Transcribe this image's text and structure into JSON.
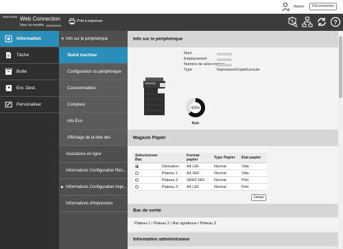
{
  "topbar": {
    "admin_label": "Admin",
    "logout_label": "Déconnexion"
  },
  "header": {
    "logo_text": "PAGE SCOPE",
    "title": "Web Connection",
    "model_label": "Nom de modèle",
    "status_label": "Prêt à imprimer"
  },
  "left_nav": [
    {
      "label": "Information",
      "icon": "info-icon",
      "active": true
    },
    {
      "label": "Tâche",
      "icon": "job-icon"
    },
    {
      "label": "Boîte",
      "icon": "box-icon"
    },
    {
      "label": "Enr. Dest.",
      "icon": "address-icon"
    },
    {
      "label": "Personaliser",
      "icon": "customize-icon"
    }
  ],
  "sub_nav": [
    {
      "label": "Info sur le périphérique",
      "expanded": true
    },
    {
      "label": "Statut machine",
      "child": true,
      "active": true
    },
    {
      "label": "Configuration du périphérique",
      "child": true
    },
    {
      "label": "Consommables",
      "child": true
    },
    {
      "label": "Compteur",
      "child": true
    },
    {
      "label": "Info Éco",
      "child": true
    },
    {
      "label": "Affichage de la liste des",
      "child": true
    },
    {
      "label": "Assistance en ligne"
    },
    {
      "label": "Informations Configuration Rés..."
    },
    {
      "label": "Informations Configuration Impr...",
      "collapsed": true
    },
    {
      "label": "Informations d'impression"
    }
  ],
  "device_info": {
    "section_title": "Info sur le périphérique",
    "keys": [
      "Nom",
      "Emplacement",
      "Numéro de série moteur",
      "Type"
    ],
    "type_value": "Impression/Copie/Lecture",
    "toner_percent": "63%",
    "toner_level": 0.63,
    "toner_color": "Noir"
  },
  "paper_tray": {
    "section_title": "Magasin Papier",
    "columns": [
      "Sélectionner Bac",
      "",
      "Format papier",
      "Type Papier",
      "Etat papier"
    ],
    "rows": [
      {
        "selected": true,
        "tray": "Dérivation",
        "size": "A4 LEF",
        "type": "Normal",
        "state": "Vide"
      },
      {
        "selected": false,
        "tray": "Plateau 1",
        "size": "A4 SEF",
        "type": "Normal",
        "state": "Vide"
      },
      {
        "selected": false,
        "tray": "Plateau 2",
        "size": "SRA3 SEF",
        "type": "Normal",
        "state": "Prêt"
      },
      {
        "selected": false,
        "tray": "Plateau 3",
        "size": "A4 LEF",
        "type": "Normal",
        "state": "Prêt"
      }
    ],
    "detail_label": "Détail"
  },
  "output_tray": {
    "section_title": "Bac de sortie",
    "text": "Plateau 1 / Plateau 2 / Bac agrafeuse / Plateau 3"
  },
  "admin_info": {
    "section_title": "Information administrateur"
  },
  "colors": {
    "accent": "#2a8fb8",
    "header": "#3c3c3c",
    "nav": "#2f2f2f",
    "subnav": "#4f4f4f"
  }
}
